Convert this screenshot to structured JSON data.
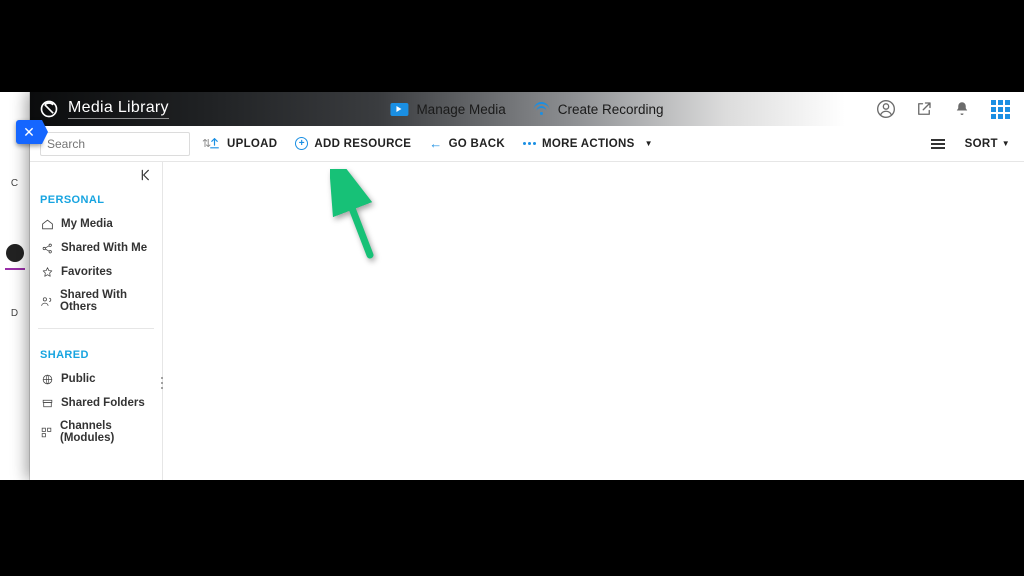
{
  "header": {
    "title": "Media Library",
    "manage_label": "Manage Media",
    "record_label": "Create Recording"
  },
  "close_btn": {
    "glyph": "✕"
  },
  "toolbar": {
    "search_placeholder": "Search",
    "upload": "UPLOAD",
    "add_resource": "ADD RESOURCE",
    "go_back": "GO BACK",
    "more_actions": "MORE ACTIONS",
    "sort": "SORT"
  },
  "sidebar": {
    "personal_head": "PERSONAL",
    "shared_head": "SHARED",
    "personal": {
      "my_media": "My Media",
      "shared_with_me": "Shared With Me",
      "favorites": "Favorites",
      "shared_with_others": "Shared With Others"
    },
    "shared": {
      "public": "Public",
      "shared_folders": "Shared Folders",
      "channels": "Channels (Modules)"
    }
  },
  "bg_app": {
    "c": "C",
    "d": "D"
  }
}
